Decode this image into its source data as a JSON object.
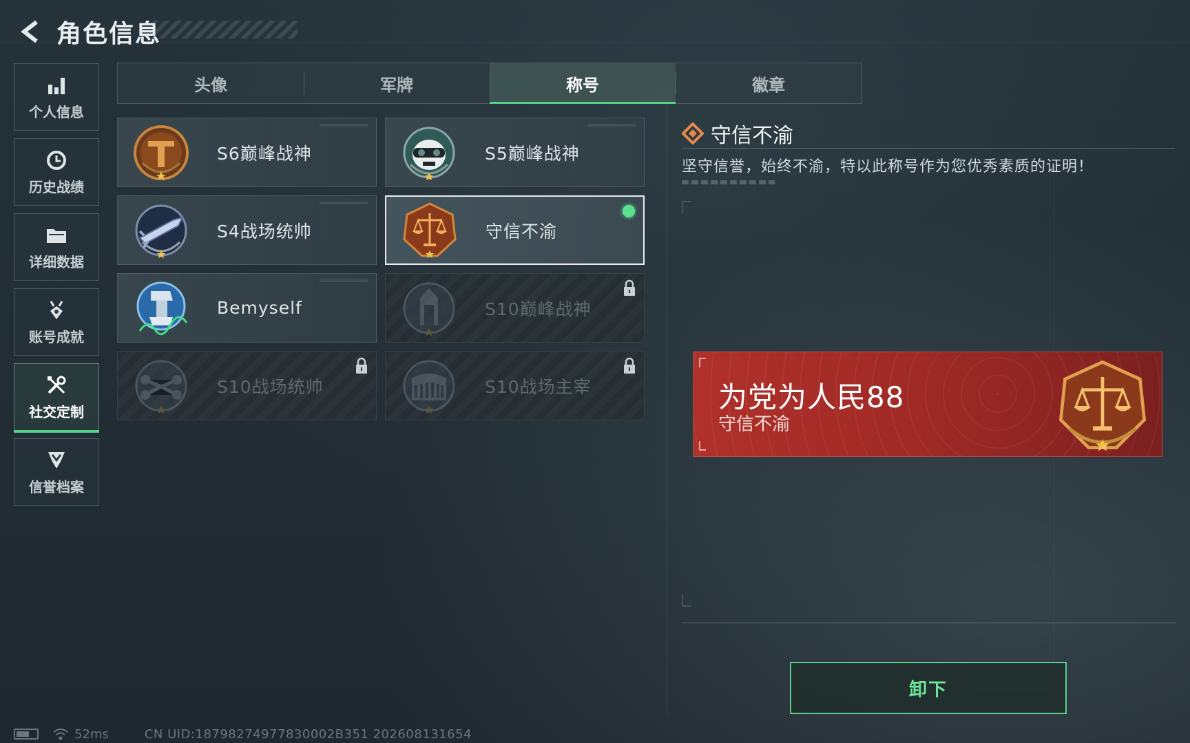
{
  "header": {
    "title": "角色信息"
  },
  "sidebar": {
    "items": [
      {
        "label": "个人信息",
        "icon": "bar-chart-icon",
        "active": false
      },
      {
        "label": "历史战绩",
        "icon": "clock-history-icon",
        "active": false
      },
      {
        "label": "详细数据",
        "icon": "folder-icon",
        "active": false
      },
      {
        "label": "账号成就",
        "icon": "medal-icon",
        "active": false
      },
      {
        "label": "社交定制",
        "icon": "tools-icon",
        "active": true
      },
      {
        "label": "信誉档案",
        "icon": "shield-chevron-icon",
        "active": false
      }
    ]
  },
  "tabs": [
    {
      "label": "头像",
      "active": false
    },
    {
      "label": "军牌",
      "active": false
    },
    {
      "label": "称号",
      "active": true
    },
    {
      "label": "徽章",
      "active": false
    }
  ],
  "titles": [
    {
      "name": "S6巅峰战神",
      "icon": "t-emblem-badge",
      "state": "owned"
    },
    {
      "name": "S5巅峰战神",
      "icon": "skull-goggles-badge",
      "state": "owned"
    },
    {
      "name": "S4战场统帅",
      "icon": "missile-badge",
      "state": "owned"
    },
    {
      "name": "守信不渝",
      "icon": "scales-badge",
      "state": "equipped"
    },
    {
      "name": "Bemyself",
      "icon": "soldier-signature-badge",
      "state": "owned"
    },
    {
      "name": "S10巅峰战神",
      "icon": "tower-badge",
      "state": "locked"
    },
    {
      "name": "S10战场统帅",
      "icon": "drone-badge",
      "state": "locked"
    },
    {
      "name": "S10战场主宰",
      "icon": "colosseum-badge",
      "state": "locked"
    }
  ],
  "detail": {
    "name": "守信不渝",
    "description": "坚守信誉，始终不渝，特以此称号作为您优秀素质的证明！"
  },
  "preview": {
    "player_name": "为党为人民88",
    "title": "守信不渝",
    "badge_icon": "scales-badge"
  },
  "actions": {
    "unequip_label": "卸下"
  },
  "footer": {
    "ping": "52ms",
    "uid": "CN UID:18798274977830002B351 202608131654"
  },
  "colors": {
    "accent_green": "#55d28a",
    "banner_red": "#a12a26",
    "background": "#222d34"
  }
}
